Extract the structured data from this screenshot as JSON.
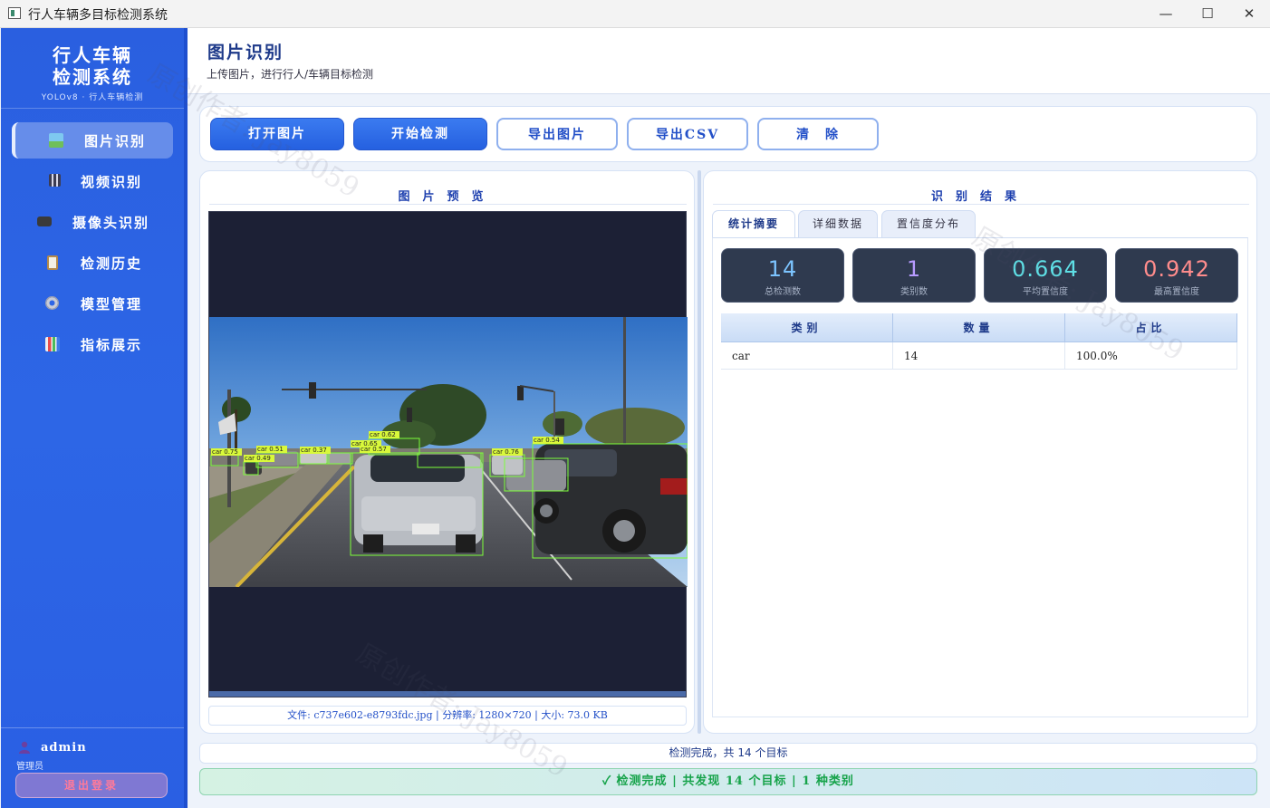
{
  "window": {
    "title": "行人车辆多目标检测系统",
    "minimize_glyph": "—",
    "maximize_glyph": "☐",
    "close_glyph": "✕"
  },
  "sidebar": {
    "brand_line1": "行人车辆",
    "brand_line2": "检测系统",
    "brand_sub": "YOLOv8 · 行人车辆检测",
    "items": [
      {
        "label": "图片识别",
        "icon": "image-icon",
        "active": true
      },
      {
        "label": "视频识别",
        "icon": "video-clapper-icon",
        "active": false
      },
      {
        "label": "摄像头识别",
        "icon": "camera-icon",
        "active": false
      },
      {
        "label": "检测历史",
        "icon": "clipboard-icon",
        "active": false
      },
      {
        "label": "模型管理",
        "icon": "gear-icon",
        "active": false
      },
      {
        "label": "指标展示",
        "icon": "bar-chart-icon",
        "active": false
      }
    ],
    "user_name": "admin",
    "user_role": "管理员",
    "logout_label": "退出登录"
  },
  "header": {
    "title": "图片识别",
    "subtitle": "上传图片，进行行人/车辆目标检测"
  },
  "toolbar": {
    "open_label": "打开图片",
    "detect_label": "开始检测",
    "export_image_label": "导出图片",
    "export_csv_label": "导出CSV",
    "clear_label": "清　除"
  },
  "preview": {
    "title": "图片预览",
    "file_info": "文件: c737e602-e8793fdc.jpg  |  分辨率: 1280×720  |  大小: 73.0 KB",
    "detections": [
      {
        "label": "car 0.75"
      },
      {
        "label": "car 0.49"
      },
      {
        "label": "car 0.51"
      },
      {
        "label": "car 0.37"
      },
      {
        "label": "car 0.65"
      },
      {
        "label": "car 0.57"
      },
      {
        "label": "car 0.62"
      },
      {
        "label": "car 0.76"
      },
      {
        "label": "car 0.54"
      }
    ]
  },
  "results": {
    "title": "识别结果",
    "tabs": [
      "统计摘要",
      "详细数据",
      "置信度分布"
    ],
    "cards": [
      {
        "value": "14",
        "label": "总检测数",
        "color": "#7cc4ff"
      },
      {
        "value": "1",
        "label": "类别数",
        "color": "#b79bff"
      },
      {
        "value": "0.664",
        "label": "平均置信度",
        "color": "#5fe0e6"
      },
      {
        "value": "0.942",
        "label": "最高置信度",
        "color": "#ff8c8c"
      }
    ],
    "table": {
      "headers": [
        "类别",
        "数量",
        "占比"
      ],
      "rows": [
        [
          "car",
          "14",
          "100.0%"
        ]
      ]
    }
  },
  "status": {
    "line": "检测完成，共 14 个目标",
    "bar": "✓  检测完成  |  共发现 14 个目标  |  1 种类别"
  },
  "watermark": "原创作者: Jay8059",
  "colors": {
    "sidebar_blue": "#2d66e6",
    "accent": "#2560e0",
    "success": "#16a34a"
  }
}
